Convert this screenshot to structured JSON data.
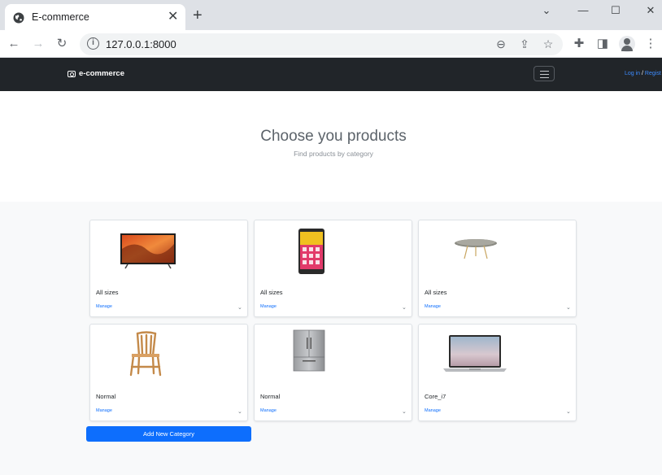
{
  "browser": {
    "tab_title": "E-commerce",
    "tab_close": "✕",
    "new_tab": "+",
    "url": "127.0.0.1:8000"
  },
  "site": {
    "brand": "e-commerce",
    "login_label": "Log in",
    "separator": " / ",
    "register_label": "Regist"
  },
  "hero": {
    "title": "Choose you products",
    "subtitle": "Find products by category"
  },
  "categories": [
    {
      "text": "All sizes",
      "link": "Manage",
      "caret": "⌄",
      "image": "tv-icon"
    },
    {
      "text": "All sizes",
      "link": "Manage",
      "caret": "⌄",
      "image": "phone-icon"
    },
    {
      "text": "All sizes",
      "link": "Manage",
      "caret": "⌄",
      "image": "table-icon"
    },
    {
      "text": "Normal",
      "link": "Manage",
      "caret": "⌄",
      "image": "chair-icon"
    },
    {
      "text": "Normal",
      "link": "Manage",
      "caret": "⌄",
      "image": "fridge-icon"
    },
    {
      "text": "Core_i7",
      "link": "Manage",
      "caret": "⌄",
      "image": "laptop-icon"
    }
  ],
  "add_button": "Add New Category",
  "colors": {
    "navbar": "#212529",
    "primary": "#0d6efd",
    "page_bg": "#f8f9fa"
  }
}
